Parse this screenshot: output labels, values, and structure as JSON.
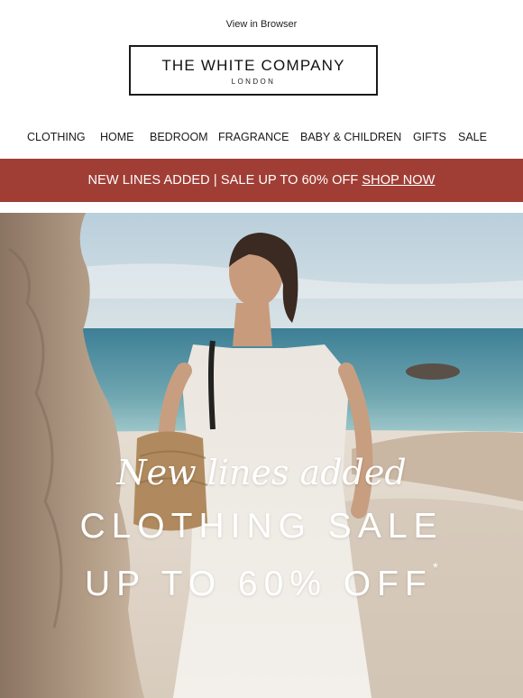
{
  "header": {
    "view_in_browser": "View in Browser",
    "logo_main": "THE WHITE COMPANY",
    "logo_sub": "LONDON"
  },
  "nav": {
    "items": [
      "CLOTHING",
      "HOME",
      "BEDROOM",
      "FRAGRANCE",
      "BABY & CHILDREN",
      "GIFTS",
      "SALE"
    ]
  },
  "promo": {
    "text": "NEW LINES ADDED | SALE UP TO 60% OFF",
    "link": "SHOP NOW",
    "background": "#a03e35"
  },
  "hero": {
    "script_line": "New lines added",
    "title": "CLOTHING SALE",
    "subtitle": "UP TO 60% OFF",
    "asterisk": "*"
  }
}
